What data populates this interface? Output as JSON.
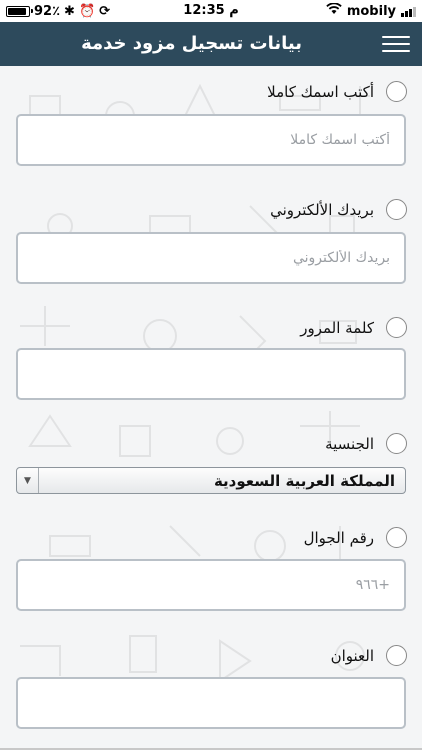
{
  "status_bar": {
    "battery_text": "92٪",
    "battery_level": 0.92,
    "time": "12:35 م",
    "carrier": "mobily",
    "icons": [
      "battery-icon",
      "bluetooth-icon",
      "alarm-icon",
      "lock-rotation-icon",
      "wifi-icon",
      "signal-icon"
    ]
  },
  "header": {
    "title": "بيانات تسجيل مزود خدمة",
    "menu_icon": "hamburger-menu-icon",
    "background": "#2d4a5c"
  },
  "form": {
    "full_name": {
      "label": "أكتب اسمك كاملا",
      "placeholder": "أكتب اسمك كاملا",
      "value": ""
    },
    "email": {
      "label": "بريدك الألكتروني",
      "placeholder": "بريدك الألكتروني",
      "value": ""
    },
    "password": {
      "label": "كلمة المرور",
      "placeholder": "",
      "value": ""
    },
    "nationality": {
      "label": "الجنسية",
      "selected": "المملكة العربية السعودية"
    },
    "mobile": {
      "label": "رقم الجوال",
      "placeholder": "+٩٦٦",
      "value": ""
    },
    "address": {
      "label": "العنوان",
      "placeholder": "",
      "value": ""
    }
  }
}
